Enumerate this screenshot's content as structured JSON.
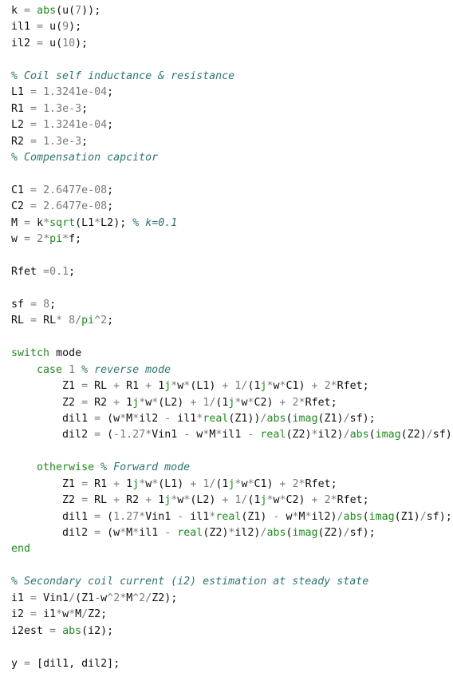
{
  "colors": {
    "keyword": "#1f8a1f",
    "number": "#7a7a7a",
    "operator": "#7a7a7a",
    "comment": "#2f7575",
    "text": "#111111"
  },
  "keywords": [
    "abs",
    "sqrt",
    "pi",
    "real",
    "imag",
    "switch",
    "case",
    "otherwise",
    "end",
    "j"
  ],
  "code_lines": [
    "k = abs(u(7));",
    "il1 = u(9);",
    "il2 = u(10);",
    "",
    "% Coil self inductance & resistance",
    "L1 = 1.3241e-04;",
    "R1 = 1.3e-3;",
    "L2 = 1.3241e-04;",
    "R2 = 1.3e-3;",
    "% Compensation capcitor",
    "",
    "C1 = 2.6477e-08;",
    "C2 = 2.6477e-08;",
    "M = k*sqrt(L1*L2); % k=0.1",
    "w = 2*pi*f;",
    "",
    "Rfet =0.1;",
    "",
    "sf = 8;",
    "RL = RL* 8/pi^2;",
    "",
    "switch mode",
    "    case 1 % reverse mode",
    "        Z1 = RL + R1 + 1j*w*(L1) + 1/(1j*w*C1) + 2*Rfet;",
    "        Z2 = R2 + 1j*w*(L2) + 1/(1j*w*C2) + 2*Rfet;",
    "        dil1 = (w*M*il2 - il1*real(Z1))/abs(imag(Z1)/sf);",
    "        dil2 = (-1.27*Vin1 - w*M*il1 - real(Z2)*il2)/abs(imag(Z2)/sf);",
    "",
    "    otherwise % Forward mode",
    "        Z1 = R1 + 1j*w*(L1) + 1/(1j*w*C1) + 2*Rfet;",
    "        Z2 = RL + R2 + 1j*w*(L2) + 1/(1j*w*C2) + 2*Rfet;",
    "        dil1 = (1.27*Vin1 - il1*real(Z1) - w*M*il2)/abs(imag(Z1)/sf);",
    "        dil2 = (w*M*il1 - real(Z2)*il2)/abs(imag(Z2)/sf);",
    "end",
    "",
    "% Secondary coil current (i2) estimation at steady state",
    "i1 = Vin1/(Z1-w^2*M^2/Z2);",
    "i2 = i1*w*M/Z2;",
    "i2est = abs(i2);",
    "",
    "y = [dil1, dil2];"
  ]
}
